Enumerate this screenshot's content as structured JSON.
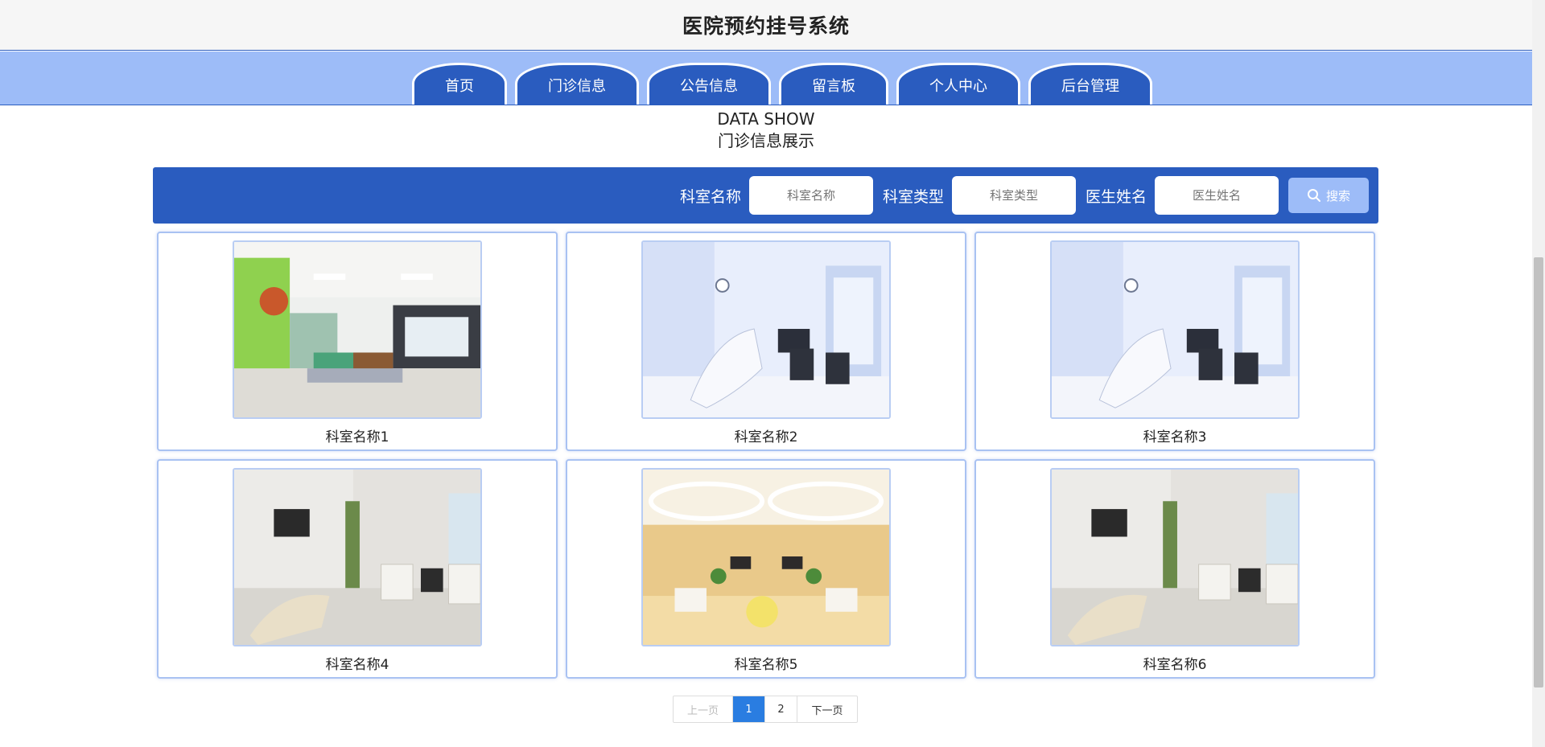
{
  "site": {
    "title": "医院预约挂号系统"
  },
  "nav": {
    "items": [
      {
        "label": "首页"
      },
      {
        "label": "门诊信息"
      },
      {
        "label": "公告信息"
      },
      {
        "label": "留言板"
      },
      {
        "label": "个人中心"
      },
      {
        "label": "后台管理"
      }
    ]
  },
  "section": {
    "title_en": "DATA SHOW",
    "title_cn": "门诊信息展示"
  },
  "search": {
    "dept_name_label": "科室名称",
    "dept_name_placeholder": "科室名称",
    "dept_type_label": "科室类型",
    "dept_type_placeholder": "科室类型",
    "doctor_label": "医生姓名",
    "doctor_placeholder": "医生姓名",
    "button_label": "搜索",
    "button_icon": "search-icon"
  },
  "cards": [
    {
      "name": "科室名称1"
    },
    {
      "name": "科室名称2"
    },
    {
      "name": "科室名称3"
    },
    {
      "name": "科室名称4"
    },
    {
      "name": "科室名称5"
    },
    {
      "name": "科室名称6"
    }
  ],
  "pagination": {
    "prev_label": "上一页",
    "pages": [
      "1",
      "2"
    ],
    "current_page": "1",
    "next_label": "下一页"
  },
  "colors": {
    "primary": "#2a5cbf",
    "nav_bg": "#9dbcf8",
    "active_page": "#2a7de1"
  }
}
